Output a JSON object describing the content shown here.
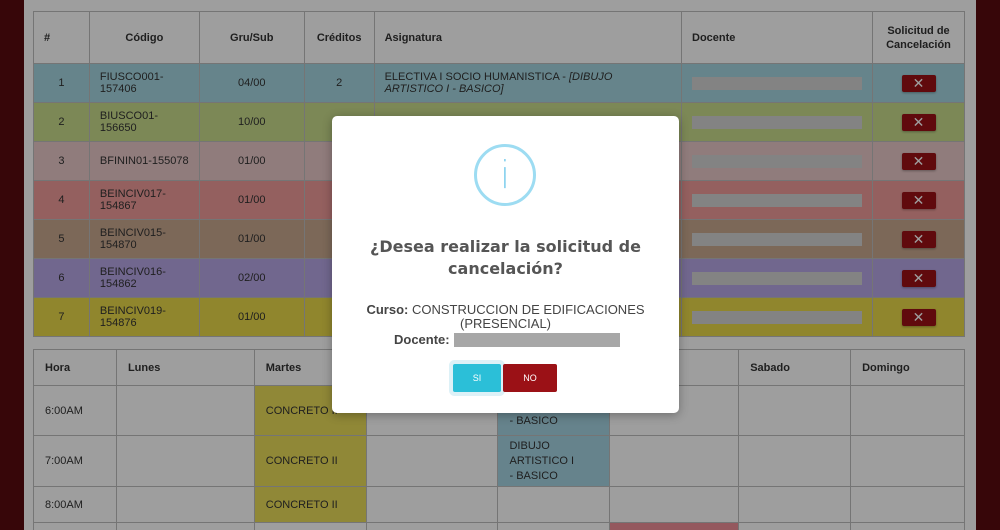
{
  "courses": {
    "headers": [
      "#",
      "Código",
      "Gru/Sub",
      "Créditos",
      "Asignatura",
      "Docente",
      "Solicitud de Cancelación"
    ],
    "rows": [
      {
        "num": "1",
        "codigo": "FIUSCO001-157406",
        "grupo": "04/00",
        "creditos": "2",
        "asignatura": "ELECTIVA I SOCIO HUMANISTICA - ",
        "asignatura_extra": "[DIBUJO ARTISTICO I - BASICO]"
      },
      {
        "num": "2",
        "codigo": "BIUSCO01-156650",
        "grupo": "10/00",
        "creditos": "",
        "asignatura": "",
        "asignatura_extra": ""
      },
      {
        "num": "3",
        "codigo": "BFININ01-155078",
        "grupo": "01/00",
        "creditos": "",
        "asignatura": "",
        "asignatura_extra": ""
      },
      {
        "num": "4",
        "codigo": "BEINCIV017-154867",
        "grupo": "01/00",
        "creditos": "",
        "asignatura": "",
        "asignatura_extra": ""
      },
      {
        "num": "5",
        "codigo": "BEINCIV015-154870",
        "grupo": "01/00",
        "creditos": "",
        "asignatura": "",
        "asignatura_extra": ""
      },
      {
        "num": "6",
        "codigo": "BEINCIV016-154862",
        "grupo": "02/00",
        "creditos": "",
        "asignatura": "",
        "asignatura_extra": ""
      },
      {
        "num": "7",
        "codigo": "BEINCIV019-154876",
        "grupo": "01/00",
        "creditos": "",
        "asignatura": "",
        "asignatura_extra": ""
      }
    ],
    "cancel_glyph": "✕"
  },
  "schedule": {
    "headers": [
      "Hora",
      "Lunes",
      "Martes",
      "",
      "",
      "",
      "Sabado",
      "Domingo"
    ],
    "rows": [
      {
        "hora": "6:00AM",
        "martes": "CONCRETO II",
        "jueves": "- BASICO"
      },
      {
        "hora": "7:00AM",
        "martes": "CONCRETO II",
        "jueves_line1": "DIBUJO ARTISTICO I",
        "jueves_line2": "- BASICO"
      },
      {
        "hora": "8:00AM",
        "martes": "CONCRETO II"
      }
    ]
  },
  "modal": {
    "icon": "i",
    "title": "¿Desea realizar la solicitud de cancelación?",
    "curso_label": "Curso:",
    "curso_value": "CONSTRUCCION DE EDIFICACIONES (PRESENCIAL)",
    "docente_label": "Docente:",
    "si_label": "SI",
    "no_label": "NO"
  }
}
